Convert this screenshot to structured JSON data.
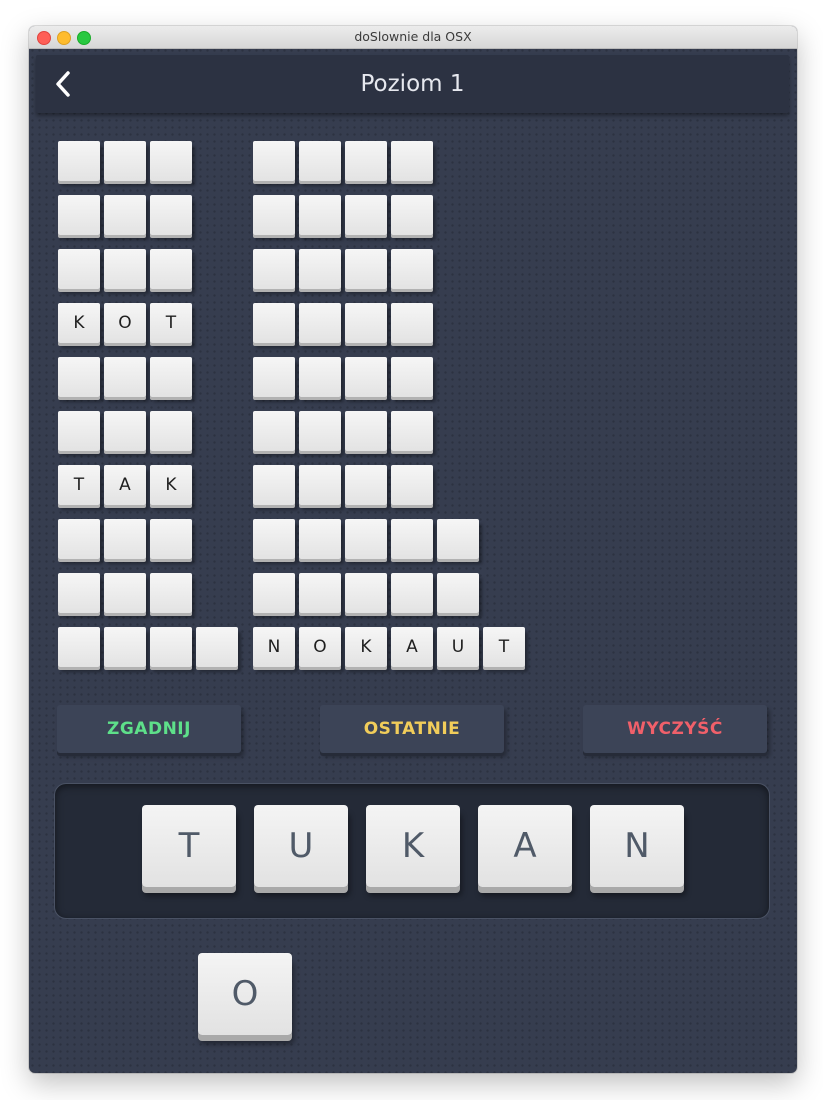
{
  "window": {
    "title": "doSlownie dla OSX"
  },
  "header": {
    "title": "Poziom 1",
    "back_icon": "chevron-left-icon"
  },
  "puzzle": {
    "column_a": [
      "   ",
      "   ",
      "   ",
      "KOT",
      "   ",
      "   ",
      "TAK",
      "   ",
      "   ",
      "    "
    ],
    "column_b": [
      "    ",
      "    ",
      "    ",
      "    ",
      "    ",
      "    ",
      "    ",
      "     ",
      "     ",
      "NOKAUT"
    ]
  },
  "buttons": {
    "guess": "ZGADNIJ",
    "last": "OSTATNIE",
    "clear": "WYCZYŚĆ"
  },
  "colors": {
    "guess": "#5ee08a",
    "last": "#f1cd5a",
    "clear": "#f0606a",
    "background": "#363d4f"
  },
  "tray_letters": [
    "T",
    "U",
    "K",
    "A",
    "N"
  ],
  "pool_letters": [
    "O"
  ]
}
